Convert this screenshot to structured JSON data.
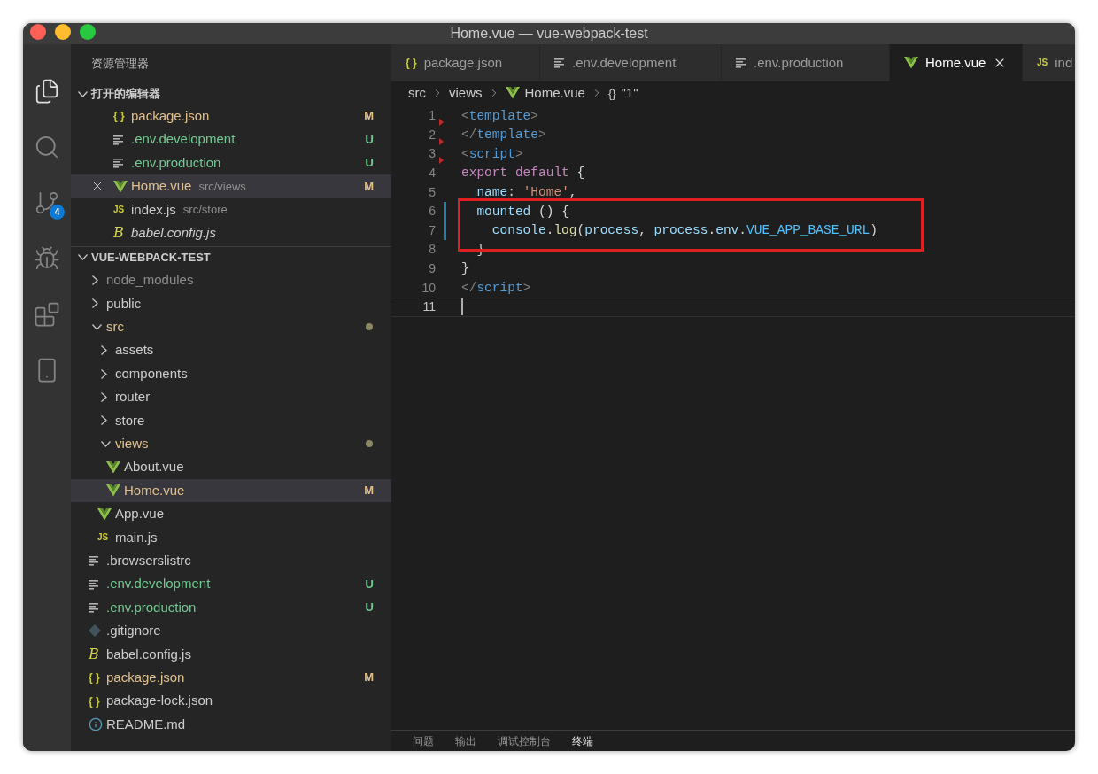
{
  "window": {
    "title": "Home.vue — vue-webpack-test"
  },
  "activity_bar": [
    {
      "kind": "files",
      "selected": true
    },
    {
      "kind": "search",
      "selected": false
    },
    {
      "kind": "source-control",
      "selected": false,
      "badge": "4"
    },
    {
      "kind": "run",
      "selected": false
    },
    {
      "kind": "extensions",
      "selected": false
    },
    {
      "kind": "panel",
      "selected": false
    }
  ],
  "sidebar": {
    "title": "资源管理器",
    "open_editors": {
      "title": "打开的编辑器",
      "expanded": true,
      "items": [
        {
          "icon": {
            "kind": "json",
            "glyph": "{ }"
          },
          "name": "package.json",
          "color": "#e2c08d",
          "badge": "M",
          "selected": false,
          "preview": false
        },
        {
          "icon": {
            "kind": "lines"
          },
          "name": ".env.development",
          "color": "#73c991",
          "badge": "U",
          "selected": false,
          "preview": false
        },
        {
          "icon": {
            "kind": "lines"
          },
          "name": ".env.production",
          "color": "#73c991",
          "badge": "U",
          "selected": false,
          "preview": false
        },
        {
          "icon": {
            "kind": "vue"
          },
          "name": "Home.vue",
          "path": "src/views",
          "color": "#e2c08d",
          "badge": "M",
          "selected": true,
          "preview": false
        },
        {
          "icon": {
            "kind": "js",
            "glyph": "JS"
          },
          "name": "index.js",
          "path": "src/store",
          "color": "#cccccc",
          "selected": false,
          "preview": false
        },
        {
          "icon": {
            "kind": "babel",
            "glyph": "B"
          },
          "name": "babel.config.js",
          "color": "#cccccc",
          "selected": false,
          "preview": true
        }
      ]
    },
    "explorer": {
      "title": "VUE-WEBPACK-TEST",
      "expanded": true,
      "items": [
        {
          "kind": "folder",
          "name": "node_modules",
          "expanded": false,
          "color": "#8c8c8c",
          "dot": false,
          "selected": false
        },
        {
          "kind": "folder",
          "name": "public",
          "expanded": false,
          "color": "#cccccc",
          "dot": false,
          "selected": false
        },
        {
          "kind": "folder",
          "name": "src",
          "expanded": true,
          "color": "#e2c08d",
          "dot": true,
          "selected": false,
          "children": [
            {
              "kind": "folder",
              "name": "assets",
              "expanded": false,
              "color": "#cccccc",
              "dot": false,
              "selected": false
            },
            {
              "kind": "folder",
              "name": "components",
              "expanded": false,
              "color": "#cccccc",
              "dot": false,
              "selected": false
            },
            {
              "kind": "folder",
              "name": "router",
              "expanded": false,
              "color": "#cccccc",
              "dot": false,
              "selected": false
            },
            {
              "kind": "folder",
              "name": "store",
              "expanded": false,
              "color": "#cccccc",
              "dot": false,
              "selected": false
            },
            {
              "kind": "folder",
              "name": "views",
              "expanded": true,
              "color": "#e2c08d",
              "dot": true,
              "selected": false,
              "children": [
                {
                  "kind": "file",
                  "icon": {
                    "kind": "vue"
                  },
                  "name": "About.vue",
                  "color": "#cccccc",
                  "selected": false
                },
                {
                  "kind": "file",
                  "icon": {
                    "kind": "vue"
                  },
                  "name": "Home.vue",
                  "color": "#e2c08d",
                  "badge": "M",
                  "selected": true
                }
              ]
            },
            {
              "kind": "file",
              "icon": {
                "kind": "vue"
              },
              "name": "App.vue",
              "color": "#cccccc",
              "selected": false
            },
            {
              "kind": "file",
              "icon": {
                "kind": "js",
                "glyph": "JS"
              },
              "name": "main.js",
              "color": "#cccccc",
              "selected": false
            }
          ]
        },
        {
          "kind": "file",
          "icon": {
            "kind": "lines"
          },
          "name": ".browserslistrc",
          "color": "#cccccc",
          "selected": false
        },
        {
          "kind": "file",
          "icon": {
            "kind": "lines"
          },
          "name": ".env.development",
          "color": "#73c991",
          "badge": "U",
          "selected": false
        },
        {
          "kind": "file",
          "icon": {
            "kind": "lines"
          },
          "name": ".env.production",
          "color": "#73c991",
          "badge": "U",
          "selected": false
        },
        {
          "kind": "file",
          "icon": {
            "kind": "git"
          },
          "name": ".gitignore",
          "color": "#cccccc",
          "selected": false
        },
        {
          "kind": "file",
          "icon": {
            "kind": "babel",
            "glyph": "B"
          },
          "name": "babel.config.js",
          "color": "#cccccc",
          "selected": false
        },
        {
          "kind": "file",
          "icon": {
            "kind": "json",
            "glyph": "{ }"
          },
          "name": "package.json",
          "color": "#e2c08d",
          "badge": "M",
          "selected": false
        },
        {
          "kind": "file",
          "icon": {
            "kind": "json",
            "glyph": "{ }"
          },
          "name": "package-lock.json",
          "color": "#cccccc",
          "selected": false
        },
        {
          "kind": "file",
          "icon": {
            "kind": "info"
          },
          "name": "README.md",
          "color": "#cccccc",
          "selected": false
        }
      ]
    }
  },
  "editor": {
    "tabs": [
      {
        "icon": {
          "kind": "json",
          "glyph": "{ }"
        },
        "label": "package.json",
        "selected": false
      },
      {
        "icon": {
          "kind": "lines"
        },
        "label": ".env.development",
        "selected": false
      },
      {
        "icon": {
          "kind": "lines"
        },
        "label": ".env.production",
        "selected": false
      },
      {
        "icon": {
          "kind": "vue"
        },
        "label": "Home.vue",
        "selected": true
      },
      {
        "icon": {
          "kind": "js",
          "glyph": "JS"
        },
        "label": "ind",
        "selected": false
      }
    ],
    "breadcrumb": [
      {
        "label": "src"
      },
      {
        "label": "views"
      },
      {
        "label": "Home.vue",
        "icon": {
          "kind": "vue"
        }
      },
      {
        "label": "\"1\"",
        "icon": {
          "kind": "braces",
          "glyph": "{}"
        }
      }
    ],
    "lines": [
      {
        "number": "1",
        "marker": true,
        "changed": false,
        "boxed": false,
        "current": false,
        "tokens": [
          {
            "kind": "punct",
            "text": "<"
          },
          {
            "kind": "tag",
            "text": "template"
          },
          {
            "kind": "punct",
            "text": ">"
          }
        ]
      },
      {
        "number": "2",
        "marker": true,
        "changed": false,
        "boxed": false,
        "current": false,
        "tokens": [
          {
            "kind": "punct",
            "text": "</"
          },
          {
            "kind": "tag",
            "text": "template"
          },
          {
            "kind": "punct",
            "text": ">"
          }
        ]
      },
      {
        "number": "3",
        "marker": true,
        "changed": false,
        "boxed": false,
        "current": false,
        "tokens": [
          {
            "kind": "punct",
            "text": "<"
          },
          {
            "kind": "tag",
            "text": "script"
          },
          {
            "kind": "punct",
            "text": ">"
          }
        ]
      },
      {
        "number": "4",
        "marker": false,
        "changed": false,
        "boxed": false,
        "current": false,
        "tokens": [
          {
            "kind": "keyword",
            "text": "export default"
          },
          {
            "kind": "plain",
            "text": " {"
          }
        ]
      },
      {
        "number": "5",
        "marker": false,
        "changed": false,
        "boxed": false,
        "current": false,
        "tokens": [
          {
            "kind": "variable",
            "text": "  name"
          },
          {
            "kind": "plain",
            "text": ": "
          },
          {
            "kind": "string",
            "text": "'Home'"
          },
          {
            "kind": "plain",
            "text": ","
          }
        ]
      },
      {
        "number": "6",
        "marker": false,
        "changed": true,
        "boxed": true,
        "current": false,
        "tokens": [
          {
            "kind": "variable",
            "text": "  mounted"
          },
          {
            "kind": "plain",
            "text": " () {"
          }
        ]
      },
      {
        "number": "7",
        "marker": false,
        "changed": true,
        "boxed": true,
        "current": false,
        "tokens": [
          {
            "kind": "variable",
            "text": "    console"
          },
          {
            "kind": "plain",
            "text": "."
          },
          {
            "kind": "function",
            "text": "log"
          },
          {
            "kind": "plain",
            "text": "("
          },
          {
            "kind": "variable",
            "text": "process"
          },
          {
            "kind": "plain",
            "text": ", "
          },
          {
            "kind": "variable",
            "text": "process"
          },
          {
            "kind": "plain",
            "text": "."
          },
          {
            "kind": "variable",
            "text": "env"
          },
          {
            "kind": "plain",
            "text": "."
          },
          {
            "kind": "constant",
            "text": "VUE_APP_BASE_URL"
          },
          {
            "kind": "plain",
            "text": ")"
          }
        ]
      },
      {
        "number": "8",
        "marker": false,
        "changed": false,
        "boxed": true,
        "current": false,
        "tokens": [
          {
            "kind": "plain",
            "text": "  }"
          }
        ]
      },
      {
        "number": "9",
        "marker": false,
        "changed": false,
        "boxed": false,
        "current": false,
        "tokens": [
          {
            "kind": "plain",
            "text": "}"
          }
        ]
      },
      {
        "number": "10",
        "marker": false,
        "changed": false,
        "boxed": false,
        "current": false,
        "tokens": [
          {
            "kind": "punct",
            "text": "</"
          },
          {
            "kind": "tag",
            "text": "script"
          },
          {
            "kind": "punct",
            "text": ">"
          }
        ]
      },
      {
        "number": "11",
        "marker": false,
        "changed": false,
        "boxed": false,
        "current": true
      }
    ]
  },
  "panel": {
    "tabs": [
      {
        "label": "问题",
        "selected": false
      },
      {
        "label": "输出",
        "selected": false
      },
      {
        "label": "调试控制台",
        "selected": false
      },
      {
        "label": "终端",
        "selected": true
      }
    ]
  }
}
